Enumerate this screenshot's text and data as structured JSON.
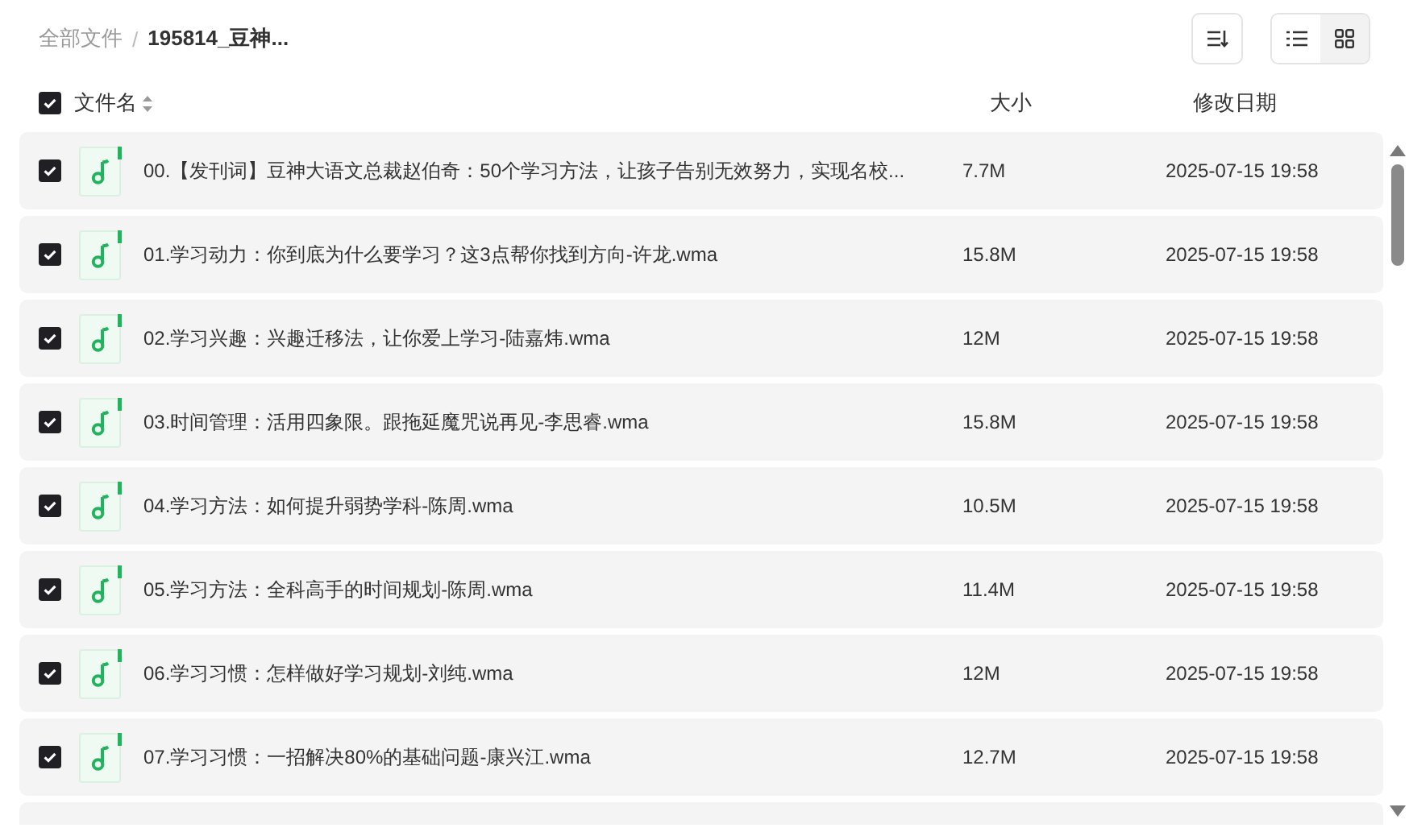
{
  "breadcrumb": {
    "root": "全部文件",
    "separator": "/",
    "current": "195814_豆神..."
  },
  "toolbar": {
    "view_modes": [
      {
        "kind": "list",
        "selected": true
      },
      {
        "kind": "grid",
        "selected": false
      }
    ]
  },
  "table": {
    "all_checked": true,
    "columns": [
      "文件名",
      "大小",
      "修改日期"
    ],
    "rows": [
      {
        "name": "00.【发刊词】豆神大语文总裁赵伯奇：50个学习方法，让孩子告别无效努力，实现名校...",
        "size": "7.7M",
        "modified": "2025-07-15 19:58",
        "checked": true
      },
      {
        "name": "01.学习动力：你到底为什么要学习？这3点帮你找到方向-许龙.wma",
        "size": "15.8M",
        "modified": "2025-07-15 19:58",
        "checked": true
      },
      {
        "name": "02.学习兴趣：兴趣迁移法，让你爱上学习-陆嘉炜.wma",
        "size": "12M",
        "modified": "2025-07-15 19:58",
        "checked": true
      },
      {
        "name": "03.时间管理：活用四象限。跟拖延魔咒说再见-李思睿.wma",
        "size": "15.8M",
        "modified": "2025-07-15 19:58",
        "checked": true
      },
      {
        "name": "04.学习方法：如何提升弱势学科-陈周.wma",
        "size": "10.5M",
        "modified": "2025-07-15 19:58",
        "checked": true
      },
      {
        "name": "05.学习方法：全科高手的时间规划-陈周.wma",
        "size": "11.4M",
        "modified": "2025-07-15 19:58",
        "checked": true
      },
      {
        "name": "06.学习习惯：怎样做好学习规划-刘纯.wma",
        "size": "12M",
        "modified": "2025-07-15 19:58",
        "checked": true
      },
      {
        "name": "07.学习习惯：一招解决80%的基础问题-康兴江.wma",
        "size": "12.7M",
        "modified": "2025-07-15 19:58",
        "checked": true
      }
    ]
  }
}
